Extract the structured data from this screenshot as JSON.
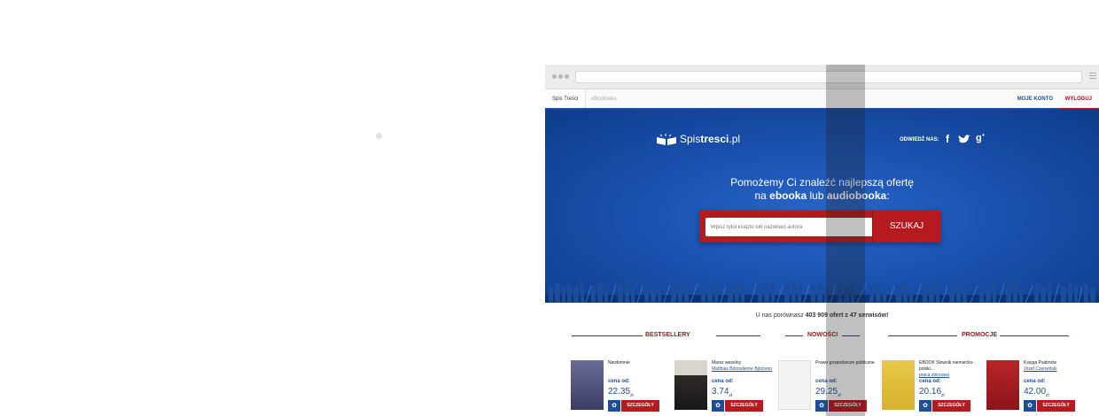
{
  "tabs": [
    "Spis Treści",
    "eBookteka",
    "MOJE KONTO",
    "WYLOGUJ"
  ],
  "logo": {
    "part1": "Spis",
    "part2": "tresci",
    "part3": ".pl"
  },
  "social_label": "ODWIEDŹ NAS:",
  "social_icons": [
    "facebook-icon",
    "twitter-icon",
    "google-plus-icon"
  ],
  "tagline": {
    "line1": "Pomożemy Ci znaleźć najlepszą ofertę",
    "line2_a": "na ",
    "line2_b": "ebooka",
    "line2_c": " lub ",
    "line2_d": "audiobooka",
    "line2_e": ":"
  },
  "search": {
    "placeholder": "Wpisz tytuł książki lub nazwisko autora",
    "button": "SZUKAJ"
  },
  "stats": {
    "prefix": "U nas porównasz ",
    "count": "403 909 ofert z 47 serwisów!"
  },
  "sections": [
    "BESTSELLERY",
    "NOWOŚCI",
    "PROMOCJE"
  ],
  "products": [
    {
      "title": "Niezłomnie",
      "author": "",
      "price_label": "cena od:",
      "price": "22.35",
      "currency": "zł",
      "details": "SZCZEGÓŁY",
      "cover": "#4a4c78"
    },
    {
      "title": "Marsz weselny",
      "author": "Matthias Biörnstierne Björnson",
      "price_label": "cena od:",
      "price": "3.74",
      "currency": "zł",
      "details": "SZCZEGÓŁY",
      "cover": "#2d2a28"
    },
    {
      "title": "Prawo gospodarcze publiczne",
      "author": "",
      "price_label": "cena od:",
      "price": "29.25",
      "currency": "zł",
      "details": "SZCZEGÓŁY",
      "cover": "#f2f2f2"
    },
    {
      "title": "EBOOK Słownik niemiecko-polski...",
      "author": "praca zbiorowa",
      "price_label": "cena od:",
      "price": "20.16",
      "currency": "zł",
      "details": "SZCZEGÓŁY",
      "cover": "#e3c33a"
    },
    {
      "title": "Księga Psalmów",
      "author": "Józef Czerwiński",
      "price_label": "cena od:",
      "price": "42.00",
      "currency": "zł",
      "details": "SZCZEGÓŁY",
      "cover": "#a81c20"
    }
  ],
  "colors": {
    "brand_blue": "#1f4e96",
    "brand_red": "#b51a1e",
    "hero_blue": "#1a52b0"
  }
}
